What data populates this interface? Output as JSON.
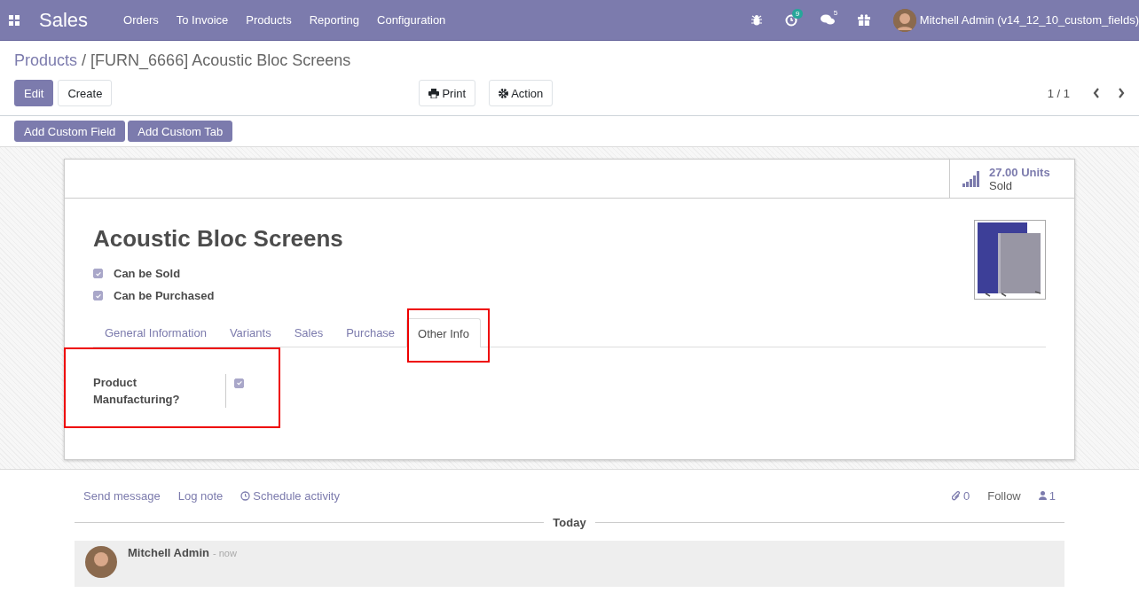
{
  "navbar": {
    "app": "Sales",
    "menu": [
      "Orders",
      "To Invoice",
      "Products",
      "Reporting",
      "Configuration"
    ],
    "activity_count": "9",
    "message_count": "5",
    "user": "Mitchell Admin (v14_12_10_custom_fields)"
  },
  "breadcrumb": {
    "parent": "Products",
    "separator": "/",
    "current": "[FURN_6666] Acoustic Bloc Screens"
  },
  "buttons": {
    "edit": "Edit",
    "create": "Create",
    "print": "Print",
    "action": "Action"
  },
  "pager": "1 / 1",
  "custom_buttons": [
    "Add Custom Field",
    "Add Custom Tab"
  ],
  "stat_button": {
    "value": "27.00 Units",
    "label": "Sold"
  },
  "product": {
    "name": "Acoustic Bloc Screens",
    "options": [
      {
        "label": "Can be Sold",
        "checked": true
      },
      {
        "label": "Can be Purchased",
        "checked": true
      }
    ]
  },
  "tabs": [
    {
      "label": "General Information",
      "selected": false
    },
    {
      "label": "Variants",
      "selected": false
    },
    {
      "label": "Sales",
      "selected": false
    },
    {
      "label": "Purchase",
      "selected": false
    },
    {
      "label": "Other Info",
      "selected": true
    }
  ],
  "fields": [
    {
      "label": "Product Manufacturing?",
      "checked": true
    }
  ],
  "chatter": {
    "send": "Send message",
    "log": "Log note",
    "schedule": "Schedule activity",
    "attachments": "0",
    "follow": "Follow",
    "followers": "1",
    "divider": "Today",
    "message": {
      "author": "Mitchell Admin",
      "time": "- now"
    }
  }
}
